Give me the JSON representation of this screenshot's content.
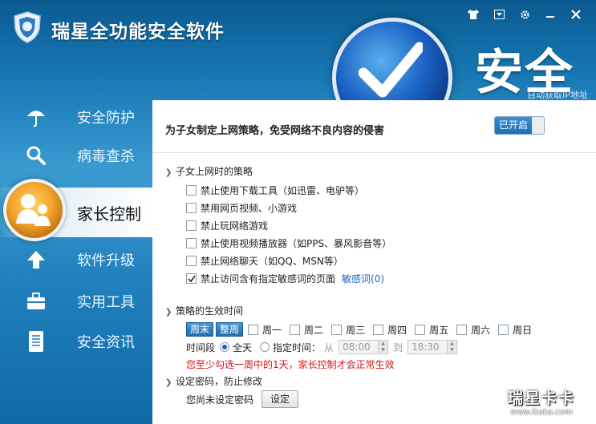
{
  "app": {
    "title": "瑞星全功能安全软件",
    "status": "安全",
    "auto_ip": "自动获取IP地址"
  },
  "window_buttons": [
    "skin-icon",
    "menu-icon",
    "gear-icon",
    "minimize-icon",
    "close-icon"
  ],
  "sidebar": {
    "items": [
      {
        "label": "安全防护",
        "icon": "umbrella-icon"
      },
      {
        "label": "病毒查杀",
        "icon": "magnifier-icon"
      },
      {
        "label": "家长控制",
        "icon": "family-icon",
        "active": true
      },
      {
        "label": "软件升级",
        "icon": "upload-arrow-icon"
      },
      {
        "label": "实用工具",
        "icon": "toolbox-icon"
      },
      {
        "label": "安全资讯",
        "icon": "newspaper-icon"
      }
    ]
  },
  "panel": {
    "title": "为子女制定上网策略，免受网络不良内容的侵害",
    "toggle_label": "已开启",
    "section_policy": "子女上网时的策略",
    "options": [
      {
        "label": "禁止使用下载工具（如迅雷、电驴等）",
        "checked": false
      },
      {
        "label": "禁用网页视频、小游戏",
        "checked": false
      },
      {
        "label": "禁止玩网络游戏",
        "checked": false
      },
      {
        "label": "禁止使用视频播放器（如PPS、暴风影音等）",
        "checked": false
      },
      {
        "label": "禁止网络聊天（如QQ、MSN等）",
        "checked": false
      },
      {
        "label": "禁止访问含有指定敏感词的页面",
        "checked": true
      }
    ],
    "sensitive_link": "敏感词(0)",
    "section_time": "策略的生效时间",
    "weekend_btn": "周末",
    "fullweek_btn": "整周",
    "days": [
      "周一",
      "周二",
      "周三",
      "周四",
      "周五",
      "周六",
      "周日"
    ],
    "time_label": "时间段",
    "all_day": "全天",
    "specified": "指定时间：",
    "from_label": "从",
    "from_value": "08:00",
    "to_label": "到",
    "to_value": "18:30",
    "warning": "您至少勾选一周中的1天，家长控制才会正常生效",
    "section_password": "设定密码，防止修改",
    "password_status": "您尚未设定密码",
    "set_btn": "设定"
  },
  "watermark": {
    "main": "瑞星卡卡",
    "sub": "www.ikaka.com"
  }
}
